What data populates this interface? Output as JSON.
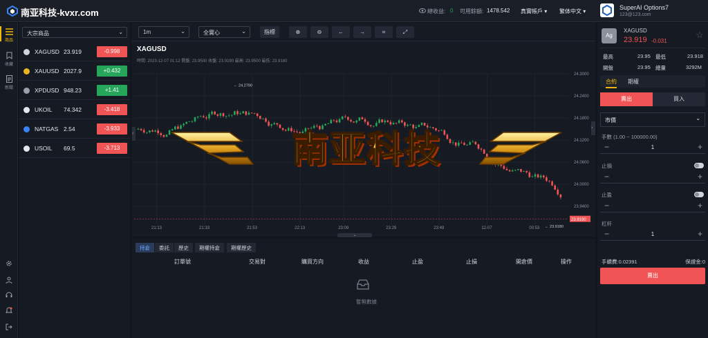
{
  "header": {
    "brand": "南亚科技-kvxr.com",
    "profit_label": "總收益:",
    "profit_value": "0",
    "balance_label": "可用餘額:",
    "balance_value": "1478.542",
    "account_type": "真實帳戶",
    "language": "繁体中文",
    "account_name": "SuperAI Options7",
    "account_email": "123@123.com"
  },
  "nav": [
    {
      "label": "商品",
      "icon": "list-icon"
    },
    {
      "label": "收藏",
      "icon": "bookmark-icon"
    },
    {
      "label": "新聞",
      "icon": "news-icon"
    }
  ],
  "products": {
    "category": "大宗商品",
    "items": [
      {
        "name": "XAGUSD",
        "price": "23.919",
        "change": "-0.998",
        "dir": "down",
        "icon_color": "#cfd3da"
      },
      {
        "name": "XAUUSD",
        "price": "2027.9",
        "change": "+0.432",
        "dir": "up",
        "icon_color": "#e6b422"
      },
      {
        "name": "XPDUSD",
        "price": "948.23",
        "change": "+1.41",
        "dir": "up",
        "icon_color": "#9aa0ab"
      },
      {
        "name": "UKOIL",
        "price": "74.342",
        "change": "-3.418",
        "dir": "down",
        "icon_color": "#e5e7eb"
      },
      {
        "name": "NATGAS",
        "price": "2.54",
        "change": "-3.933",
        "dir": "down",
        "icon_color": "#3b82f6"
      },
      {
        "name": "USOIL",
        "price": "69.5",
        "change": "-3.713",
        "dir": "down",
        "icon_color": "#e5e7eb"
      }
    ]
  },
  "toolbar": {
    "interval": "1m",
    "mode": "全實心",
    "indicator": "指標"
  },
  "chart": {
    "symbol": "XAGUSD",
    "ohlc": "時間: 2023-12-07 01:12  開盤: 23.9500  收盤: 23.9190  最高: 23.9500  最低: 23.9180",
    "watermark": "南亚科技",
    "high_label": "24.2790",
    "low_label": "23.9180",
    "last_price": "23.9190",
    "y_ticks": [
      "24.3000",
      "24.2400",
      "24.1800",
      "24.1200",
      "24.0600",
      "24.0000",
      "23.9400"
    ],
    "x_ticks": [
      "21:13",
      "21:33",
      "21:53",
      "22:13",
      "23:09",
      "23:29",
      "23:49",
      "12-07",
      "00:53"
    ]
  },
  "orders": {
    "tabs": [
      "持倉",
      "委託",
      "歷史",
      "期權持倉",
      "期權歷史"
    ],
    "headers": [
      "訂單號",
      "交易對",
      "購買方向",
      "收益",
      "止盈",
      "止損",
      "開倉價",
      "操作"
    ],
    "empty": "暫無數據"
  },
  "trade": {
    "symbol": "XAGUSD",
    "icon_text": "Ag",
    "price": "23.919",
    "change": "-0.031",
    "high_label": "最高",
    "high": "23.95",
    "low_label": "最低",
    "low": "23.918",
    "open_label": "開盤",
    "open": "23.95",
    "vol_label": "總量",
    "vol": "3292M",
    "tab_contract": "合約",
    "tab_option": "期權",
    "sell": "賣出",
    "buy": "買入",
    "order_type": "市價",
    "qty_label": "手數 (1.00 ~ 100000.00)",
    "qty": "1",
    "sl_label": "止損",
    "tp_label": "止盈",
    "lev_label": "杠杆",
    "lev": "1",
    "fee": "手續費:0.02391",
    "margin": "保證金:0",
    "submit": "賣出"
  },
  "colors": {
    "up": "#26a65b",
    "down": "#f05454",
    "accent": "#f0b90b"
  }
}
